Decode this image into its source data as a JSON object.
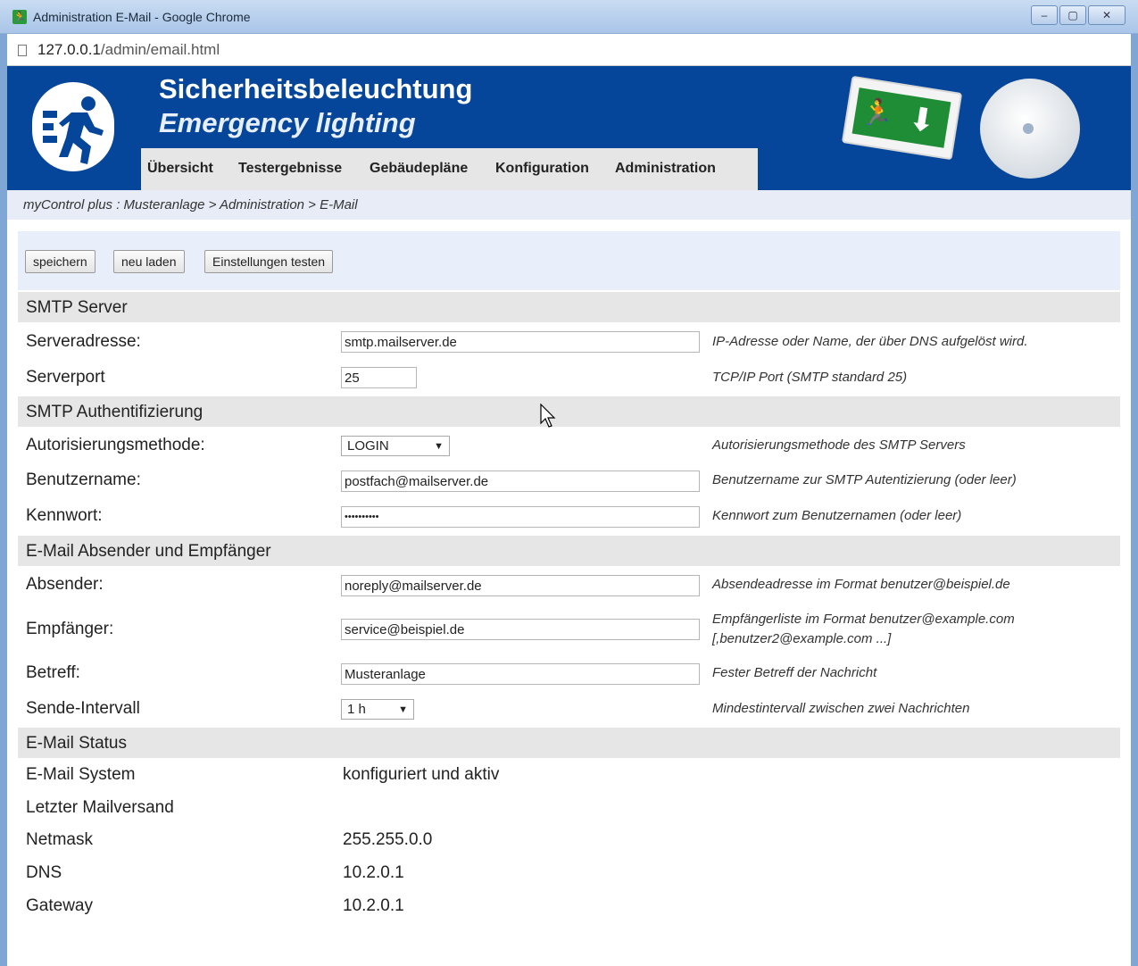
{
  "window": {
    "title": "Administration E-Mail - Google Chrome",
    "url_host": "127.0.0.1",
    "url_path": "/admin/email.html"
  },
  "banner": {
    "title_de": "Sicherheitsbeleuchtung",
    "title_en": "Emergency lighting",
    "menu": [
      "Übersicht",
      "Testergebnisse",
      "Gebäudepläne",
      "Konfiguration",
      "Administration"
    ]
  },
  "breadcrumb": "myControl plus : Musteranlage > Administration > E-Mail",
  "toolbar": {
    "save": "speichern",
    "reload": "neu laden",
    "test": "Einstellungen testen"
  },
  "smtp_server": {
    "heading": "SMTP Server",
    "address": {
      "label": "Serveradresse:",
      "value": "smtp.mailserver.de",
      "help": "IP-Adresse oder Name, der über DNS aufgelöst wird."
    },
    "port": {
      "label": "Serverport",
      "value": "25",
      "help": "TCP/IP Port (SMTP standard 25)"
    }
  },
  "smtp_auth": {
    "heading": "SMTP Authentifizierung",
    "method": {
      "label": "Autorisierungsmethode:",
      "value": "LOGIN",
      "help": "Autorisierungsmethode des SMTP Servers"
    },
    "username": {
      "label": "Benutzername:",
      "value": "postfach@mailserver.de",
      "help": "Benutzername zur SMTP Autentizierung (oder leer)"
    },
    "password": {
      "label": "Kennwort:",
      "value": "••••••••••",
      "help": "Kennwort zum Benutzernamen (oder leer)"
    }
  },
  "email": {
    "heading": "E-Mail Absender und Empfänger",
    "sender": {
      "label": "Absender:",
      "value": "noreply@mailserver.de",
      "help": "Absendeadresse im Format benutzer@beispiel.de"
    },
    "recipient": {
      "label": "Empfänger:",
      "value": "service@beispiel.de",
      "help1": "Empfängerliste im Format benutzer@example.com",
      "help2": "[,benutzer2@example.com ...]"
    },
    "subject": {
      "label": "Betreff:",
      "value": "Musteranlage",
      "help": "Fester Betreff der Nachricht"
    },
    "interval": {
      "label": "Sende-Intervall",
      "value": "1 h",
      "help": "Mindestintervall zwischen zwei Nachrichten"
    }
  },
  "status": {
    "heading": "E-Mail Status",
    "rows": [
      {
        "label": "E-Mail System",
        "value": "konfiguriert und aktiv"
      },
      {
        "label": "Letzter Mailversand",
        "value": ""
      },
      {
        "label": "Netmask",
        "value": "255.255.0.0"
      },
      {
        "label": "DNS",
        "value": "10.2.0.1"
      },
      {
        "label": "Gateway",
        "value": "10.2.0.1"
      }
    ]
  }
}
